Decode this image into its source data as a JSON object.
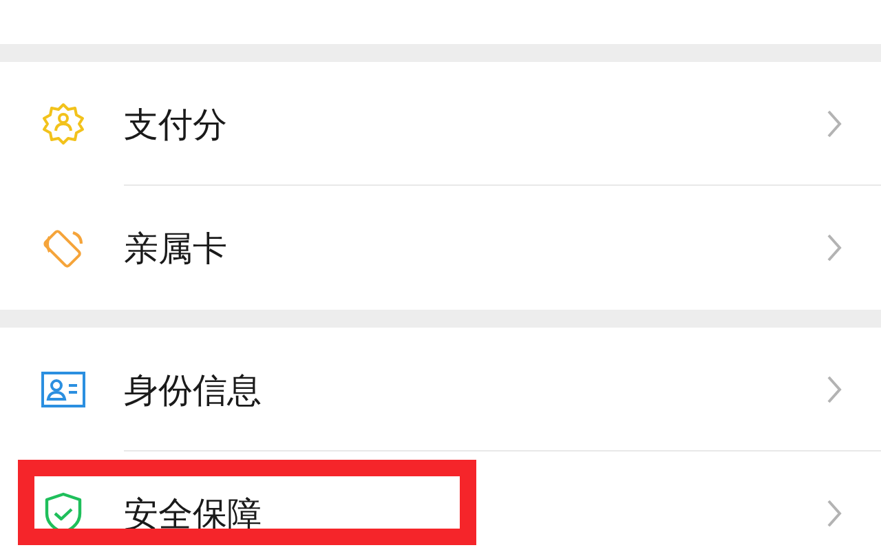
{
  "groups": [
    {
      "items": [
        {
          "label": "支付分",
          "highlighted": false
        },
        {
          "label": "亲属卡",
          "highlighted": false
        }
      ]
    },
    {
      "items": [
        {
          "label": "身份信息",
          "highlighted": false
        },
        {
          "label": "安全保障",
          "highlighted": true
        }
      ]
    }
  ]
}
